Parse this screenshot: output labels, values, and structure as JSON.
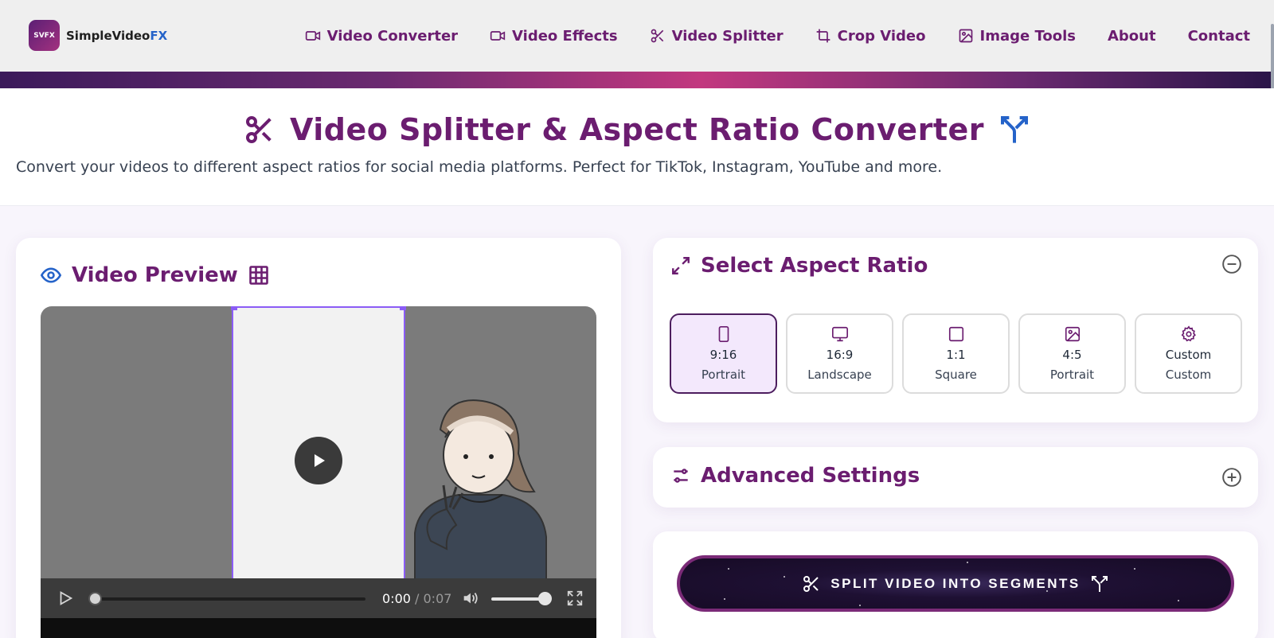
{
  "brand": {
    "name_prefix": "SimpleVideo",
    "name_suffix": "FX",
    "mark": "SVFX"
  },
  "nav": [
    {
      "label": "Video Converter",
      "icon": "video-camera-icon"
    },
    {
      "label": "Video Effects",
      "icon": "video-camera-icon"
    },
    {
      "label": "Video Splitter",
      "icon": "scissors-icon"
    },
    {
      "label": "Crop Video",
      "icon": "crop-icon"
    },
    {
      "label": "Image Tools",
      "icon": "image-icon"
    },
    {
      "label": "About",
      "icon": ""
    },
    {
      "label": "Contact",
      "icon": ""
    }
  ],
  "page": {
    "title": "Video Splitter & Aspect Ratio Converter",
    "subtitle": "Convert your videos to different aspect ratios for social media platforms. Perfect for TikTok, Instagram, YouTube and more."
  },
  "preview": {
    "title": "Video Preview",
    "time_current": "0:00",
    "time_separator": " / ",
    "time_total": "0:07"
  },
  "aspect": {
    "title": "Select Aspect Ratio",
    "options": [
      {
        "value": "9:16",
        "label": "Portrait",
        "icon": "phone-icon",
        "selected": true
      },
      {
        "value": "16:9",
        "label": "Landscape",
        "icon": "monitor-icon",
        "selected": false
      },
      {
        "value": "1:1",
        "label": "Square",
        "icon": "square-icon",
        "selected": false
      },
      {
        "value": "4:5",
        "label": "Portrait",
        "icon": "image-icon",
        "selected": false
      },
      {
        "value": "Custom",
        "label": "Custom",
        "icon": "gear-icon",
        "selected": false
      }
    ]
  },
  "advanced": {
    "title": "Advanced Settings"
  },
  "split": {
    "label": "SPLIT VIDEO INTO SEGMENTS"
  },
  "colors": {
    "brand": "#6b1d70",
    "accent_blue": "#2563c9",
    "selected_border": "#4c1d5e",
    "selected_bg": "#f3e8fc"
  }
}
